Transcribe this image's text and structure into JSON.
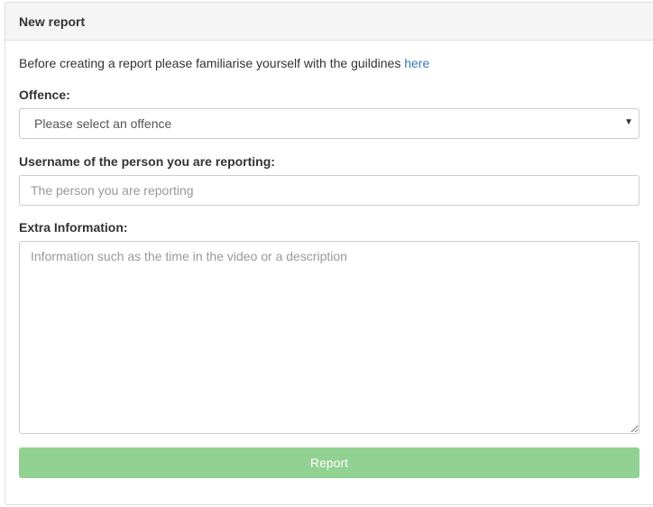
{
  "panel": {
    "title": "New report"
  },
  "intro": {
    "text": "Before creating a report please familiarise yourself with the guildines ",
    "link_label": "here"
  },
  "offence": {
    "label": "Offence:",
    "selected": "Please select an offence"
  },
  "username": {
    "label": "Username of the person you are reporting:",
    "placeholder": "The person you are reporting"
  },
  "extra": {
    "label": "Extra Information:",
    "placeholder": "Information such as the time in the video or a description"
  },
  "submit": {
    "label": "Report"
  },
  "colors": {
    "link": "#337ab7",
    "button": "#91d191",
    "heading_bg": "#f5f5f5"
  }
}
